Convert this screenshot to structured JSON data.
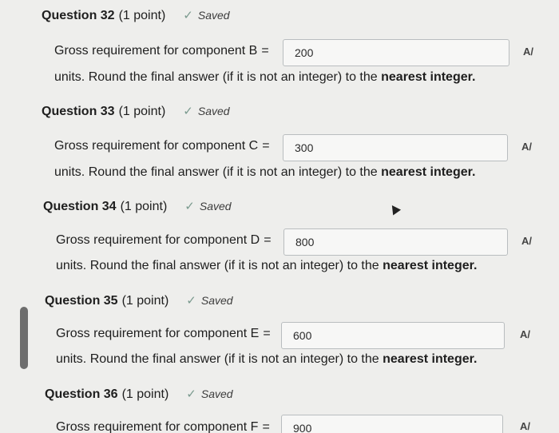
{
  "saved_label": "Saved",
  "equals": "=",
  "tool_label": "A/",
  "suffix_prefix": "units. Round the final answer (if it is not an integer) to the",
  "suffix_bold": "nearest integer.",
  "questions": [
    {
      "number": "Question 32",
      "points": "(1 point)",
      "prompt": "Gross requirement for component B",
      "value": "200"
    },
    {
      "number": "Question 33",
      "points": "(1 point)",
      "prompt": "Gross requirement for component C",
      "value": "300"
    },
    {
      "number": "Question 34",
      "points": "(1 point)",
      "prompt": "Gross requirement for component D",
      "value": "800"
    },
    {
      "number": "Question 35",
      "points": "(1 point)",
      "prompt": "Gross requirement for component E",
      "value": "600"
    },
    {
      "number": "Question 36",
      "points": "(1 point)",
      "prompt": "Gross requirement for component F",
      "value": "900"
    }
  ]
}
